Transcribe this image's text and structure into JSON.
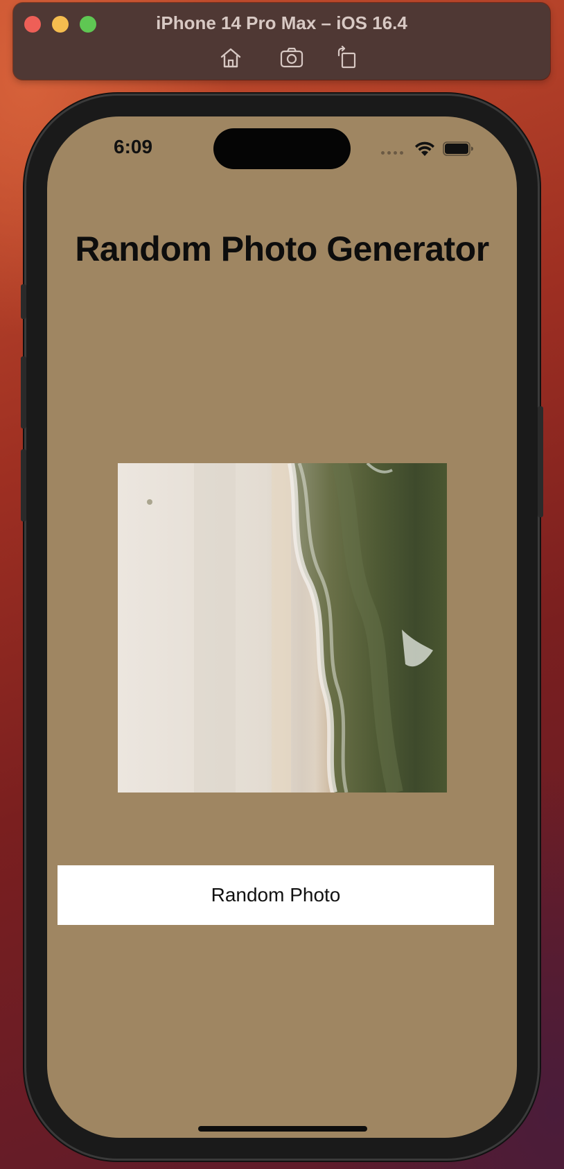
{
  "simulator": {
    "title": "iPhone 14 Pro Max – iOS 16.4",
    "tools": [
      "home-icon",
      "screenshot-icon",
      "rotate-icon"
    ]
  },
  "status_bar": {
    "time": "6:09",
    "icons": [
      "cellular-dots-icon",
      "wifi-icon",
      "battery-icon"
    ]
  },
  "app": {
    "title": "Random Photo Generator",
    "photo": {
      "description_icon": "beach-aerial-photo"
    },
    "button_label": "Random Photo"
  },
  "colors": {
    "screen_background": "#9f8662",
    "button_background": "#ffffff",
    "title_text": "#0d0d0d",
    "simulator_bar": "#4f3834"
  }
}
